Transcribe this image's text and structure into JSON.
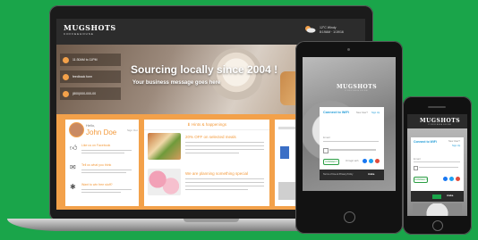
{
  "colors": {
    "background": "#1aa54a",
    "accent": "#f39a3c",
    "wifi_blue": "#1f9ad6",
    "connect_green": "#2a9d43"
  },
  "laptop": {
    "logo_main": "MUGSHOTS",
    "logo_sub": "COFFEEHOUSE",
    "weather": {
      "line1": "12°C Windy",
      "line2": "8:19AM · 1/19/16",
      "icon": "sun-cloud-icon"
    },
    "hero_title": "Sourcing locally since 2004 !",
    "hero_message": "Your business message goes here",
    "info_items": [
      {
        "icon": "clock-icon",
        "text": "11:30AM to 11PM"
      },
      {
        "icon": "feedback-icon",
        "text": "feedback form"
      },
      {
        "icon": "phone-icon",
        "text": "(800)000-000-00"
      }
    ],
    "profile": {
      "hello": "Hello,",
      "name": "John Doe",
      "sign_out": "Sign Out",
      "items": [
        {
          "icon": "thumbs-up-icon",
          "title": "Like us on Facebook"
        },
        {
          "icon": "chat-icon",
          "title": "Tell us what you think"
        },
        {
          "icon": "sparkle-icon",
          "title": "Want to win free stuff?"
        }
      ]
    },
    "news": {
      "header": "Hints & happenings",
      "items": [
        {
          "title": "20% OFF on selected meals"
        },
        {
          "title": "We are planning something special"
        }
      ]
    }
  },
  "tablet": {
    "logo_main": "MUGSHOTS",
    "logo_sub": "COFFEEHOUSE",
    "dialog": {
      "title": "Connect to WiFi",
      "new_user": "New User?",
      "sign_up": "Sign Up",
      "email_placeholder": "Email",
      "connect": "CONNECT",
      "or_login_with": "Or login with",
      "footer_left": "Terms of Use & Privacy Policy",
      "footer_brand": "Aruba"
    }
  },
  "phone": {
    "logo_main": "MUGSHOTS",
    "logo_sub": "COFFEEHOUSE",
    "dialog": {
      "title": "Connect to WiFi",
      "new_user": "New User?",
      "sign_up": "Sign Up",
      "email_placeholder": "Email",
      "connect": "CONNECT",
      "footer_brand": "Aruba"
    }
  }
}
